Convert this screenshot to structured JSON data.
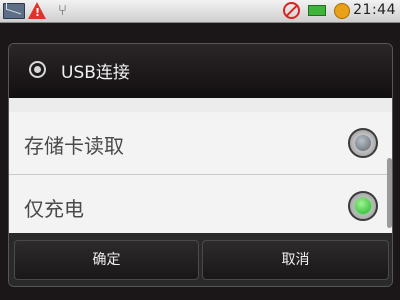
{
  "status_bar": {
    "time": "21:44",
    "icons": [
      "mail-icon",
      "warning-icon",
      "usb-icon",
      "no-sign-icon",
      "battery-icon",
      "signal-icon",
      "alarm-icon"
    ],
    "warning_glyph": "!",
    "usb_glyph": "⑂"
  },
  "dialog": {
    "title": "USB连接",
    "options": [
      {
        "label": "存储卡读取",
        "selected": false
      },
      {
        "label": "仅充电",
        "selected": true
      }
    ],
    "buttons": {
      "ok_label": "确定",
      "cancel_label": "取消"
    }
  },
  "colors": {
    "selected_radio": "#2ec43a",
    "dialog_bg": "#111111",
    "list_bg": "#f2f2f2"
  }
}
